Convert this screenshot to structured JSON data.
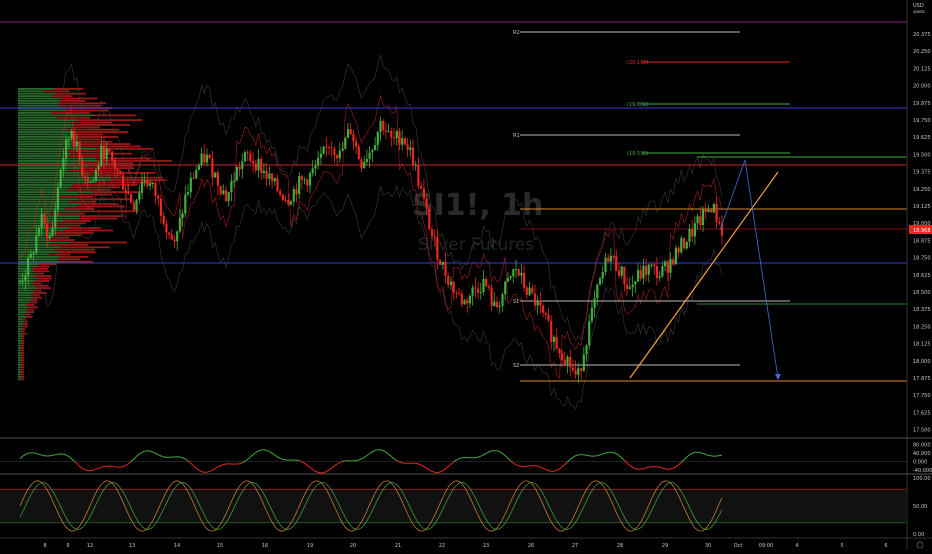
{
  "symbol": {
    "code": "SI1!, 1h",
    "name": "Silver Futures"
  },
  "currency": {
    "top": "USD",
    "sub": "ajeetc"
  },
  "colors": {
    "up": "#3fae3f",
    "down": "#e8291f",
    "background": "#000000",
    "support": "#3a3ad8",
    "resistance": "#c62828",
    "orange": "#d98a2e",
    "trendline": "#f0a33a",
    "projection": "#3f6ed8",
    "magenta": "#a01ea0"
  },
  "price_axis": {
    "labels": [
      "20.375",
      "20.250",
      "20.125",
      "20.000",
      "19.875",
      "19.750",
      "19.625",
      "19.500",
      "19.375",
      "19.250",
      "19.125",
      "19.000",
      "18.875",
      "18.750",
      "18.625",
      "18.500",
      "18.375",
      "18.250",
      "18.125",
      "18.000",
      "17.875",
      "17.750",
      "17.625",
      "17.500"
    ],
    "last_price_badge": "18.968"
  },
  "time_axis": {
    "labels": [
      "8",
      "9",
      "12",
      "13",
      "14",
      "15",
      "16",
      "19",
      "20",
      "21",
      "22",
      "23",
      "26",
      "27",
      "28",
      "29",
      "30",
      "Oct",
      "09:00",
      "4",
      "5",
      "6"
    ]
  },
  "pivot_labels": {
    "r2": "R2",
    "fib_top": "(20.196)",
    "fib_mid": "(19.882)",
    "r1": "R1",
    "fib_low": "(19.535)",
    "s1": "S1",
    "s2": "S2"
  },
  "indicator1": {
    "labels": [
      "80.000",
      "40.000",
      "0.000",
      "-40.000"
    ]
  },
  "indicator2": {
    "labels": [
      "100.00",
      "50.00",
      "0.00"
    ]
  },
  "chart_data": {
    "type": "candlestick",
    "instrument": "SI1!",
    "timeframe": "1h",
    "yaxis": {
      "ylim": [
        17.5,
        20.4
      ],
      "unit": "USD"
    },
    "close_path": [
      [
        8,
        18.6
      ],
      [
        9,
        18.75
      ],
      [
        10,
        19.05
      ],
      [
        11,
        18.9
      ],
      [
        12,
        19.45
      ],
      [
        13,
        19.7
      ],
      [
        14,
        19.4
      ],
      [
        15,
        19.3
      ],
      [
        16,
        19.55
      ],
      [
        17,
        19.45
      ],
      [
        18,
        19.3
      ],
      [
        19,
        19.15
      ],
      [
        20,
        19.35
      ],
      [
        21,
        19.25
      ],
      [
        22,
        19.05
      ],
      [
        23,
        18.85
      ],
      [
        24,
        19.2
      ],
      [
        25,
        19.4
      ],
      [
        26,
        19.5
      ],
      [
        27,
        19.35
      ],
      [
        28,
        19.2
      ],
      [
        29,
        19.4
      ],
      [
        30,
        19.5
      ],
      [
        31,
        19.45
      ],
      [
        32,
        19.35
      ],
      [
        33,
        19.25
      ],
      [
        34,
        19.2
      ],
      [
        35,
        19.3
      ],
      [
        36,
        19.35
      ],
      [
        37,
        19.45
      ],
      [
        38,
        19.6
      ],
      [
        39,
        19.5
      ],
      [
        40,
        19.7
      ],
      [
        41,
        19.45
      ],
      [
        42,
        19.55
      ],
      [
        43,
        19.75
      ],
      [
        44,
        19.6
      ],
      [
        45,
        19.65
      ],
      [
        46,
        19.5
      ],
      [
        47,
        19.2
      ],
      [
        48,
        18.9
      ],
      [
        49,
        18.7
      ],
      [
        50,
        18.55
      ],
      [
        51,
        18.45
      ],
      [
        52,
        18.55
      ],
      [
        53,
        18.6
      ],
      [
        54,
        18.4
      ],
      [
        55,
        18.55
      ],
      [
        56,
        18.7
      ],
      [
        57,
        18.55
      ],
      [
        58,
        18.45
      ],
      [
        59,
        18.3
      ],
      [
        60,
        18.15
      ],
      [
        61,
        18.05
      ],
      [
        62,
        17.9
      ],
      [
        63,
        18.25
      ],
      [
        64,
        18.55
      ],
      [
        65,
        18.8
      ],
      [
        66,
        18.7
      ],
      [
        67,
        18.55
      ],
      [
        68,
        18.65
      ],
      [
        69,
        18.7
      ],
      [
        70,
        18.65
      ],
      [
        71,
        18.75
      ],
      [
        72,
        18.85
      ],
      [
        73,
        18.95
      ],
      [
        74,
        19.05
      ],
      [
        75,
        19.15
      ],
      [
        76,
        18.97
      ]
    ],
    "levels": [
      {
        "name": "R2",
        "price": 20.3
      },
      {
        "name": "fib",
        "label": "(20.196)",
        "price": 20.196
      },
      {
        "name": "fib",
        "label": "(19.882)",
        "price": 19.882
      },
      {
        "name": "R1",
        "price": 19.715
      },
      {
        "name": "fib",
        "label": "(19.535)",
        "price": 19.535
      },
      {
        "name": "resistance",
        "price": 19.46
      },
      {
        "name": "horizontal",
        "price": 19.13
      },
      {
        "name": "support",
        "price": 18.76
      },
      {
        "name": "S1",
        "price": 18.42
      },
      {
        "name": "S2",
        "price": 18.0
      },
      {
        "name": "horizontal",
        "price": 17.86
      }
    ],
    "indicator1": {
      "ylim": [
        -60,
        100
      ],
      "ticks": [
        80,
        40,
        0,
        -40
      ]
    },
    "indicator2": {
      "ylim": [
        0,
        100
      ],
      "ticks": [
        100,
        50,
        0
      ]
    },
    "grid": false
  }
}
